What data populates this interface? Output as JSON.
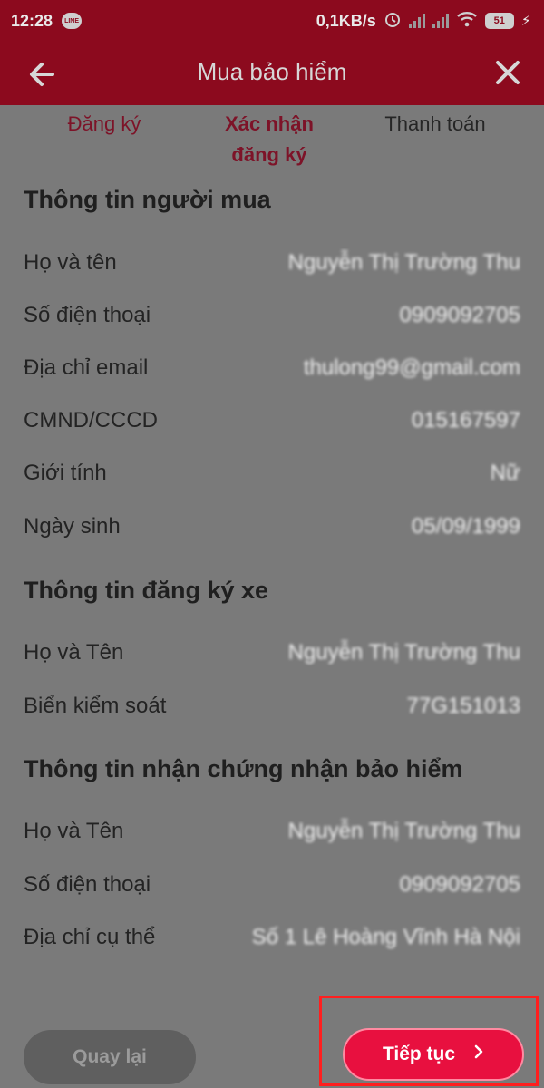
{
  "status_bar": {
    "time": "12:28",
    "line_badge": "LINE",
    "network_speed": "0,1KB/s",
    "battery": "51"
  },
  "header": {
    "title": "Mua bảo hiểm"
  },
  "steps": [
    {
      "label": "Đăng ký"
    },
    {
      "label": "Xác nhận đăng ký"
    },
    {
      "label": "Thanh toán"
    }
  ],
  "buyer_info": {
    "title": "Thông tin người mua",
    "rows": [
      {
        "label": "Họ và tên",
        "value": "Nguyễn Thị Trường Thu"
      },
      {
        "label": "Số điện thoại",
        "value": "0909092705"
      },
      {
        "label": "Địa chỉ email",
        "value": "thulong99@gmail.com"
      },
      {
        "label": "CMND/CCCD",
        "value": "015167597"
      },
      {
        "label": "Giới tính",
        "value": "Nữ"
      },
      {
        "label": "Ngày sinh",
        "value": "05/09/1999"
      }
    ]
  },
  "vehicle_info": {
    "title": "Thông tin đăng ký xe",
    "rows": [
      {
        "label": "Họ và Tên",
        "value": "Nguyễn Thị Trường Thu"
      },
      {
        "label": "Biển kiểm soát",
        "value": "77G151013"
      }
    ]
  },
  "certificate_info": {
    "title": "Thông tin nhận chứng nhận bảo hiểm",
    "rows": [
      {
        "label": "Họ và Tên",
        "value": "Nguyễn Thị Trường Thu"
      },
      {
        "label": "Số điện thoại",
        "value": "0909092705"
      },
      {
        "label": "Địa chỉ cụ thể",
        "value": "Số 1 Lê Hoàng Vĩnh Hà Nội"
      }
    ]
  },
  "buttons": {
    "back": "Quay lại",
    "next": "Tiếp tục"
  },
  "colors": {
    "header_bg": "#8c0a1e",
    "accent": "#e8103f",
    "highlight": "#ff1f1f"
  }
}
